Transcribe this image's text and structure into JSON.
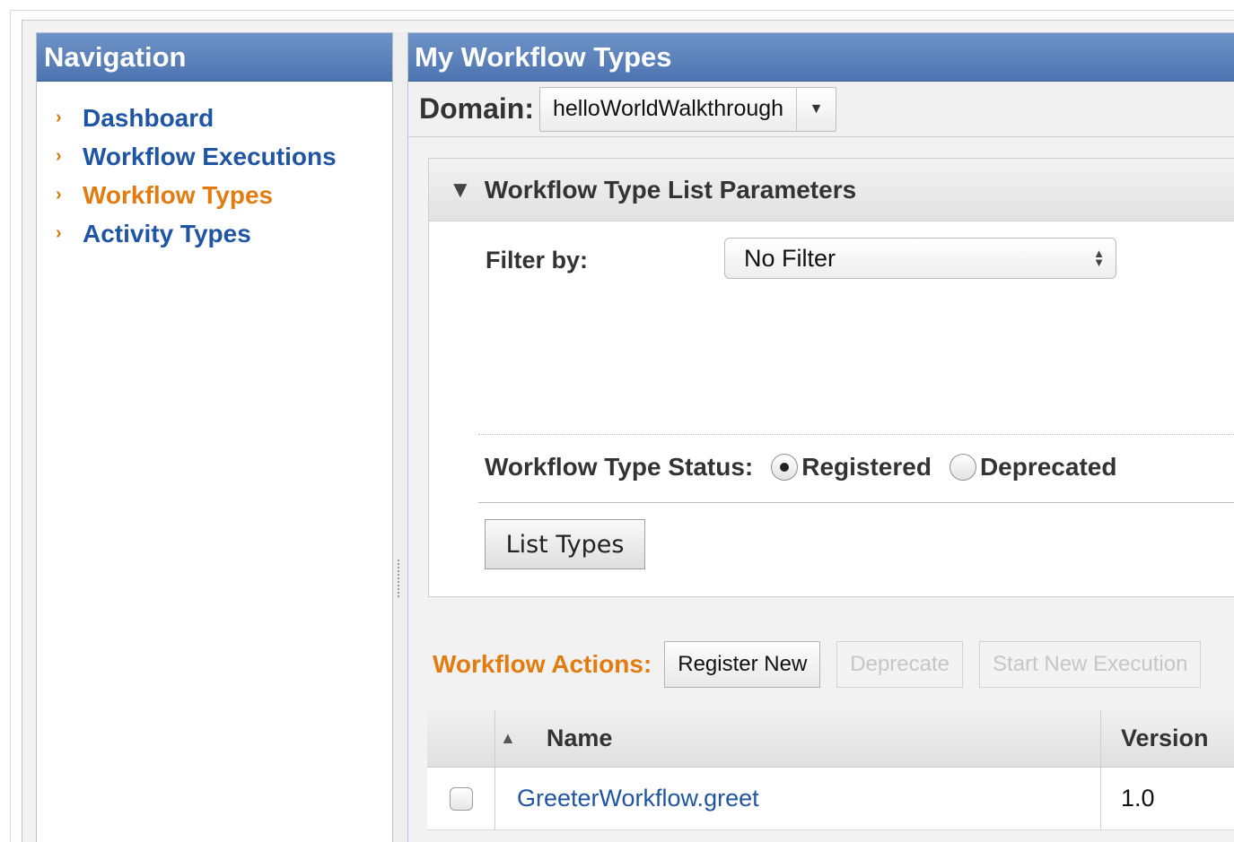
{
  "navigation": {
    "title": "Navigation",
    "items": [
      {
        "label": "Dashboard",
        "active": false
      },
      {
        "label": "Workflow Executions",
        "active": false
      },
      {
        "label": "Workflow Types",
        "active": true
      },
      {
        "label": "Activity Types",
        "active": false
      }
    ]
  },
  "main": {
    "title": "My Workflow Types",
    "domain_label": "Domain:",
    "domain_value": "helloWorldWalkthrough"
  },
  "params": {
    "title": "Workflow Type List Parameters",
    "filter_label": "Filter by:",
    "filter_value": "No Filter",
    "status_label": "Workflow Type Status:",
    "status_options": [
      {
        "label": "Registered",
        "selected": true
      },
      {
        "label": "Deprecated",
        "selected": false
      }
    ],
    "list_button": "List Types"
  },
  "actions": {
    "label": "Workflow Actions:",
    "register_new": "Register New",
    "deprecate": "Deprecate",
    "start_new_execution": "Start New Execution"
  },
  "table": {
    "columns": {
      "name": "Name",
      "version": "Version"
    },
    "rows": [
      {
        "name": "GreeterWorkflow.greet",
        "version": "1.0",
        "checked": false
      }
    ]
  },
  "colors": {
    "header_blue": "#4c74b0",
    "link_blue": "#1f55a4",
    "accent_orange": "#e37c10"
  }
}
